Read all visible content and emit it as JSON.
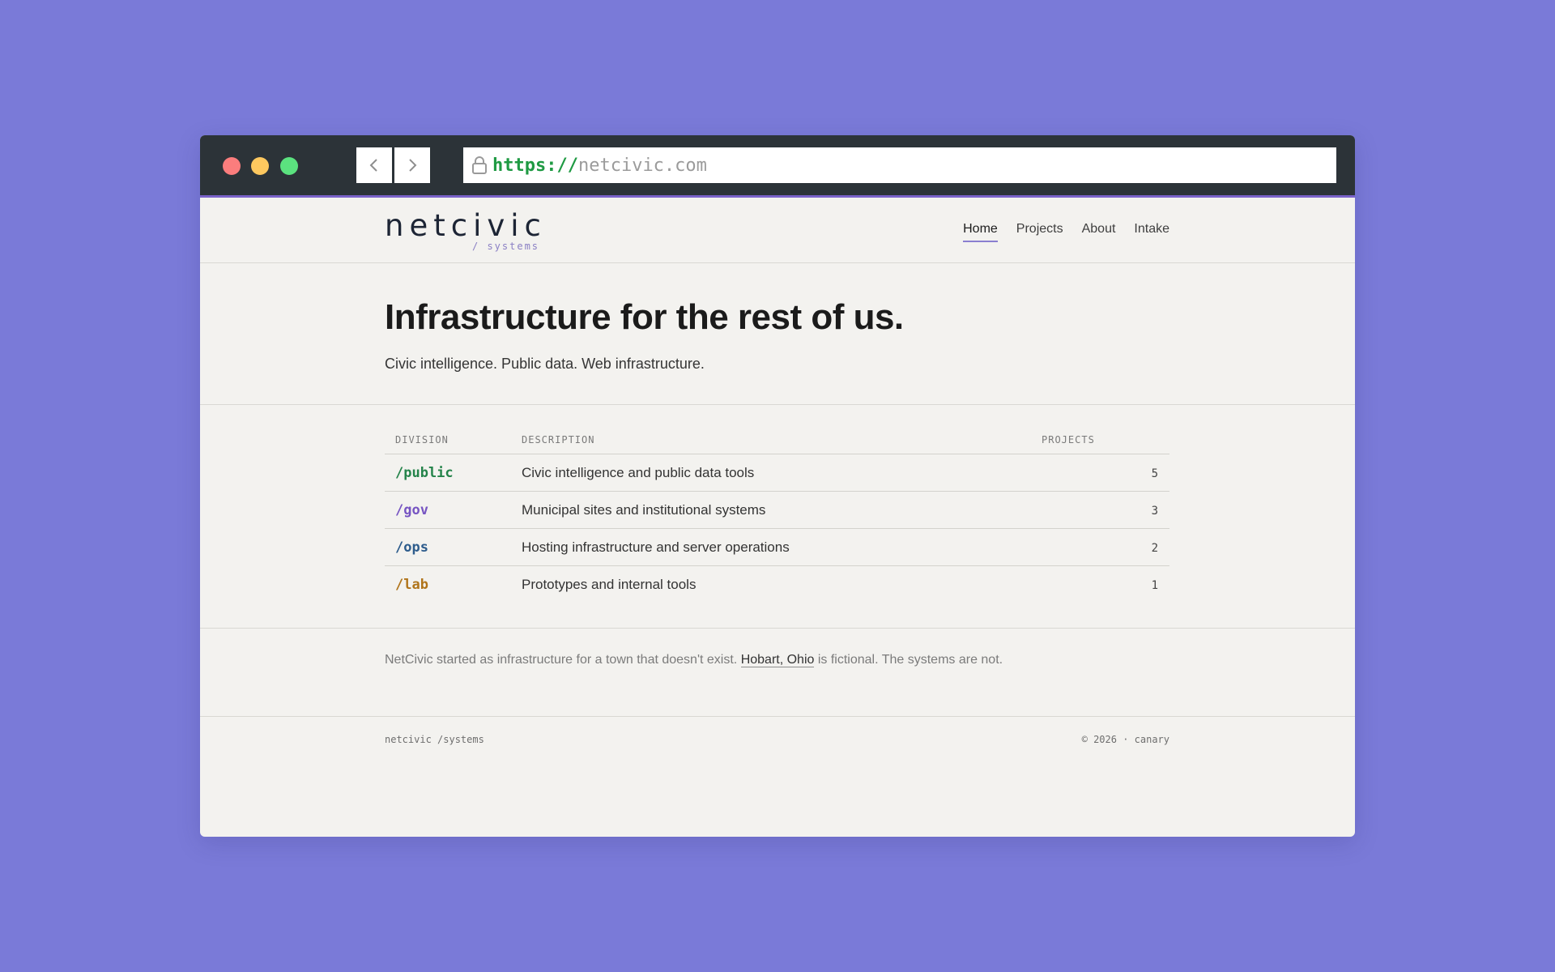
{
  "browser": {
    "url_scheme": "https://",
    "url_host": "netcivic.com",
    "icons": [
      "back-chevron-icon",
      "forward-chevron-icon",
      "lock-icon"
    ]
  },
  "brand": {
    "name": "netcivic",
    "sub": "/ systems"
  },
  "nav": {
    "items": [
      {
        "label": "Home",
        "active": true
      },
      {
        "label": "Projects"
      },
      {
        "label": "About"
      },
      {
        "label": "Intake"
      }
    ]
  },
  "hero": {
    "title": "Infrastructure for the rest of us.",
    "subtitle": "Civic intelligence. Public data. Web infrastructure."
  },
  "divisions": {
    "headers": [
      "DIVISION",
      "DESCRIPTION",
      "PROJECTS"
    ],
    "rows": [
      {
        "path": "/public",
        "description": "Civic intelligence and public data tools",
        "projects": "5",
        "color": "#24834a"
      },
      {
        "path": "/gov",
        "description": "Municipal sites and institutional systems",
        "projects": "3",
        "color": "#7654c2"
      },
      {
        "path": "/ops",
        "description": "Hosting infrastructure and server operations",
        "projects": "2",
        "color": "#2d5c8c"
      },
      {
        "path": "/lab",
        "description": "Prototypes and internal tools",
        "projects": "1",
        "color": "#b0741a"
      }
    ]
  },
  "note": {
    "before": "NetCivic started as infrastructure for a town that doesn't exist. ",
    "link": "Hobart, Ohio",
    "after": " is fictional. The systems are not."
  },
  "footer": {
    "left": "netcivic /systems",
    "right": "© 2026 · canary"
  },
  "colors": {
    "background": "#7a7ad8",
    "titlebar": "#2c3338",
    "accent": "#7a62c9",
    "page": "#f3f2ef"
  }
}
